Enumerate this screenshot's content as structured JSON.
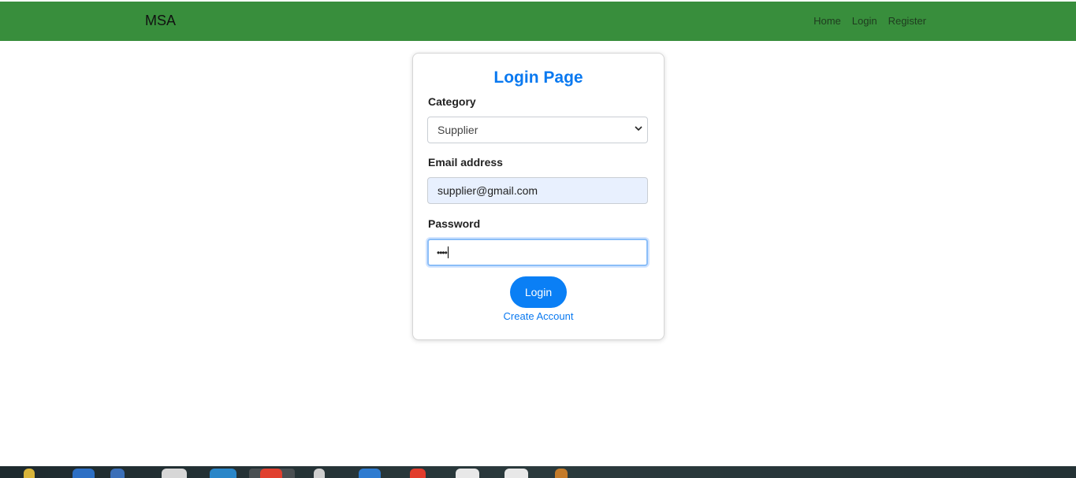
{
  "navbar": {
    "brand": "MSA",
    "links": [
      "Home",
      "Login",
      "Register"
    ]
  },
  "login": {
    "title": "Login Page",
    "category_label": "Category",
    "category_value": "Supplier",
    "email_label": "Email address",
    "email_value": "supplier@gmail.com",
    "password_label": "Password",
    "password_value": "••••",
    "login_button": "Login",
    "create_account_link": "Create Account"
  },
  "colors": {
    "navbar": "#388e3c",
    "accent": "#0a7ff5",
    "email_autofill": "#e8f0fe"
  },
  "taskbar": {
    "icons": [
      "launcher-icon",
      "app-icon",
      "app-icon",
      "app-icon",
      "app-icon",
      "browser-icon",
      "app-icon",
      "app-icon",
      "app-icon",
      "app-icon",
      "app-icon",
      "app-icon"
    ]
  }
}
